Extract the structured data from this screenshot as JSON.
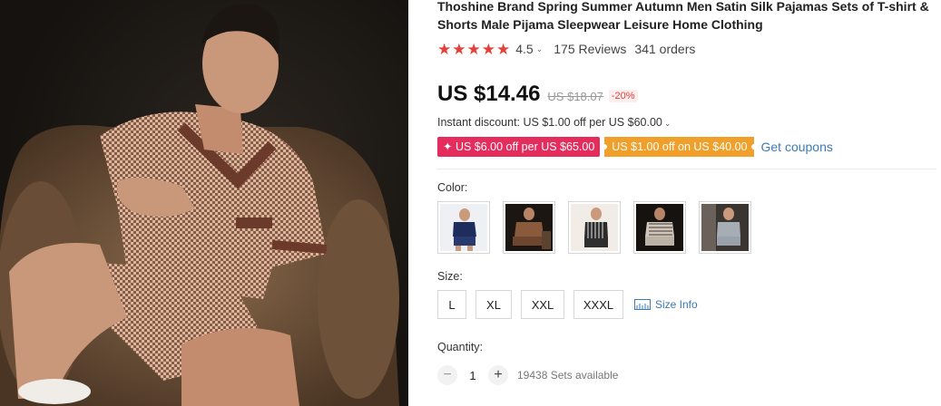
{
  "product": {
    "title": "Thoshine Brand Spring Summer Autumn Men Satin Silk Pajamas Sets of T-shirt & Shorts Male Pijama Sleepwear Leisure Home Clothing",
    "image_alt": "Man in houndstooth satin pajama set seated on leather armchair"
  },
  "rating": {
    "stars": 4.5,
    "value": "4.5",
    "caret": "⌄",
    "reviews": "175 Reviews",
    "orders": "341 orders",
    "star_glyph": "★",
    "star_color": "#e3403a"
  },
  "price": {
    "current": "US $14.46",
    "original": "US $18.07",
    "discount": "-20%"
  },
  "instant_discount": {
    "text": "Instant discount: US $1.00 off per US $60.00",
    "caret": "⌄"
  },
  "coupons": {
    "red": "✦ US $6.00 off per US $65.00",
    "orange": "US $1.00 off on US $40.00",
    "link": "Get coupons",
    "red_color": "#e42c5d",
    "orange_color": "#f0a02a"
  },
  "color": {
    "label": "Color:",
    "options": [
      "navy-white",
      "brown-dark",
      "striped-black-white",
      "houndstooth-dark",
      "grey-checked"
    ]
  },
  "size": {
    "label": "Size:",
    "options": [
      "L",
      "XL",
      "XXL",
      "XXXL"
    ],
    "info_link": "Size Info"
  },
  "quantity": {
    "label": "Quantity:",
    "minus": "−",
    "value": "1",
    "plus": "+",
    "available": "19438 Sets available"
  }
}
